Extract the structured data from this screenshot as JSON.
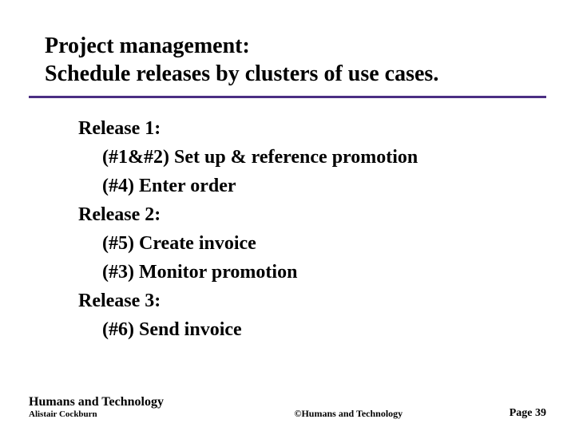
{
  "title": {
    "line1": "Project management:",
    "line2": "Schedule releases by clusters of use cases."
  },
  "releases": [
    {
      "heading": "Release 1:",
      "items": [
        "(#1&#2) Set up & reference promotion",
        "(#4) Enter order"
      ]
    },
    {
      "heading": "Release 2:",
      "items": [
        "(#5) Create invoice",
        "(#3) Monitor promotion"
      ]
    },
    {
      "heading": "Release 3:",
      "items": [
        "(#6) Send invoice"
      ]
    }
  ],
  "footer": {
    "org": "Humans and Technology",
    "author": "Alistair Cockburn",
    "copyright": "©Humans and Technology",
    "page": "Page 39"
  }
}
